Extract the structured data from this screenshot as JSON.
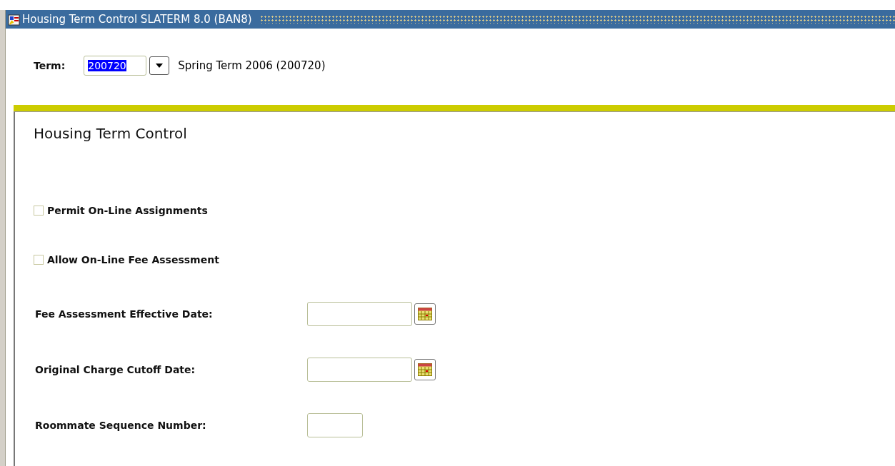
{
  "window": {
    "title": "Housing Term Control  SLATERM  8.0  (BAN8)"
  },
  "key_block": {
    "label": "Term:",
    "value": "200720",
    "value_highlighted": true,
    "description": "Spring Term 2006 (200720)"
  },
  "section": {
    "title": "Housing Term Control"
  },
  "checkboxes": [
    {
      "label": "Permit On-Line Assignments",
      "checked": false
    },
    {
      "label": "Allow On-Line Fee Assessment",
      "checked": false
    }
  ],
  "fields": [
    {
      "label": "Fee Assessment Effective Date:",
      "kind": "date"
    },
    {
      "label": "Original Charge Cutoff Date:",
      "kind": "date"
    },
    {
      "label": "Roommate Sequence Number:",
      "kind": "number"
    }
  ]
}
